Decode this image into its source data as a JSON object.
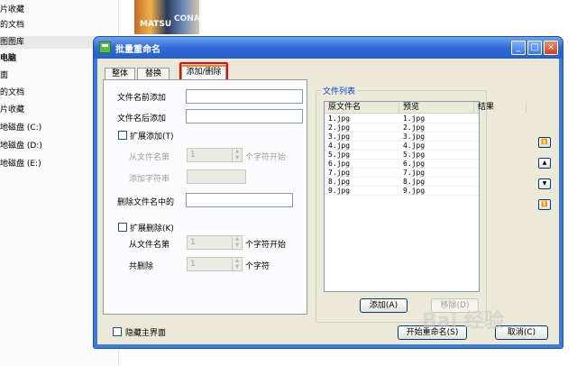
{
  "background": {
    "sidebar_items": [
      "片收藏",
      "的文档",
      "图图库",
      "电脑",
      "面",
      "的文档",
      "片收藏",
      "地磁盘 (C:)",
      "地磁盘 (D:)",
      "地磁盘 (E:)"
    ],
    "thumb_text_1": "MATSU",
    "thumb_text_2": "CONA"
  },
  "dialog": {
    "title": "批量重命名",
    "buttons": {
      "minimize": "_",
      "maximize": "□",
      "close": "×"
    },
    "tabs": [
      {
        "label": "整体"
      },
      {
        "label": "替换"
      },
      {
        "label": "添加/删除"
      }
    ],
    "add": {
      "prefix_label": "文件名前添加",
      "prefix_value": "",
      "suffix_label": "文件名后添加",
      "suffix_value": "",
      "extend_add_label": "扩展添加(T)",
      "from_char_label": "从文件名第",
      "from_char_value": "1",
      "from_char_unit": "个字符开始",
      "add_string_label": "添加字符串"
    },
    "remove": {
      "delete_in_label": "删除文件名中的",
      "delete_in_value": "",
      "extend_delete_label": "扩展删除(K)",
      "from_char_label": "从文件名第",
      "from_char_value": "1",
      "from_char_unit": "个字符开始",
      "total_delete_label": "共删除",
      "total_delete_value": "1",
      "total_delete_unit": "个字符"
    },
    "file_list": {
      "title": "文件列表",
      "columns": [
        "原文件名",
        "预览",
        "结果"
      ],
      "rows": [
        {
          "original": "1.jpg",
          "preview": "1.jpg",
          "result": ""
        },
        {
          "original": "2.jpg",
          "preview": "2.jpg",
          "result": ""
        },
        {
          "original": "3.jpg",
          "preview": "3.jpg",
          "result": ""
        },
        {
          "original": "4.jpg",
          "preview": "4.jpg",
          "result": ""
        },
        {
          "original": "5.jpg",
          "preview": "5.jpg",
          "result": ""
        },
        {
          "original": "6.jpg",
          "preview": "6.jpg",
          "result": ""
        },
        {
          "original": "7.jpg",
          "preview": "7.jpg",
          "result": ""
        },
        {
          "original": "8.jpg",
          "preview": "8.jpg",
          "result": ""
        },
        {
          "original": "9.jpg",
          "preview": "9.jpg",
          "result": ""
        }
      ],
      "add_button": "添加(A)",
      "remove_button": "移除(D)"
    },
    "hide_main_label": "隐藏主界面",
    "start_button": "开始重命名(S)",
    "cancel_button": "取消(C)"
  },
  "watermark": "Bai 经验"
}
